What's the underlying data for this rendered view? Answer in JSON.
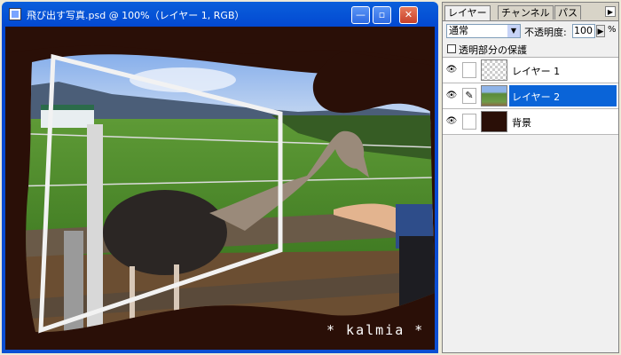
{
  "window": {
    "title": "飛び出す写真.psd @ 100%（レイヤー 1, RGB）",
    "minimize_symbol": "—",
    "maximize_symbol": "▫",
    "close_symbol": "✕"
  },
  "canvas": {
    "watermark": "* kalmia *"
  },
  "layers_panel": {
    "tabs": [
      {
        "label": "レイヤー",
        "active": true
      },
      {
        "label": "チャンネル",
        "active": false
      },
      {
        "label": "パス",
        "active": false
      }
    ],
    "menu_arrow": "▶",
    "blend_mode": "通常",
    "opacity_label": "不透明度:",
    "opacity_value": "100",
    "opacity_unit": "%",
    "lock_transparency_label": "透明部分の保護",
    "layers": [
      {
        "name": "レイヤー 1",
        "thumb": "checker",
        "selected": false,
        "link_icon": ""
      },
      {
        "name": "レイヤー 2",
        "thumb": "photo",
        "selected": true,
        "link_icon": "✎"
      },
      {
        "name": "背景",
        "thumb": "dark",
        "selected": false,
        "link_icon": ""
      }
    ]
  },
  "colors": {
    "title_bar": "#0a5fdb",
    "selection": "#0a64d8",
    "background_layer": "#2a0f07"
  }
}
